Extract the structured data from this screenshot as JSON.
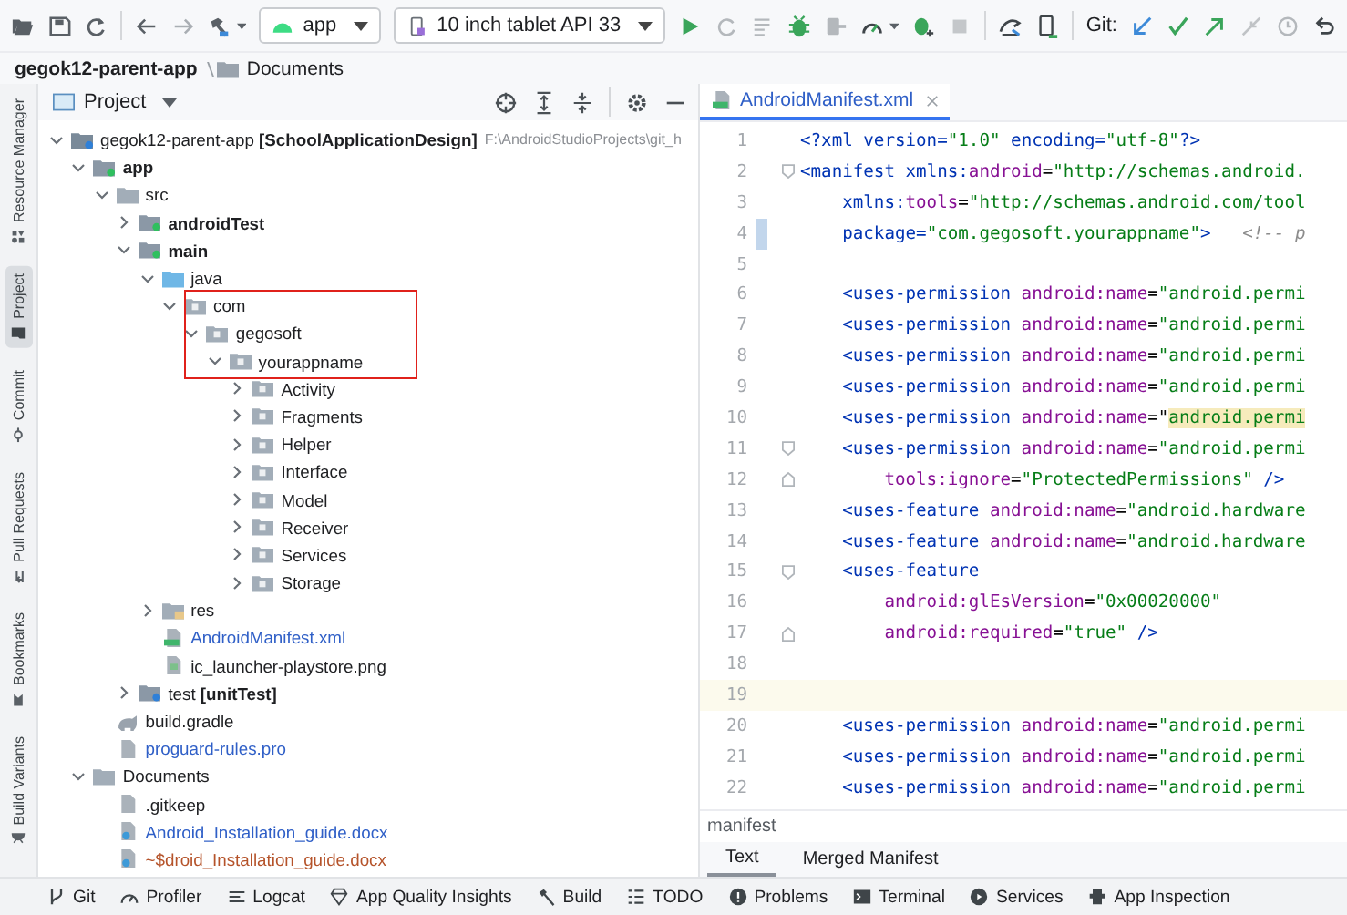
{
  "toolbar": {
    "run_config": "app",
    "device": "10 inch tablet API 33",
    "git_label": "Git:"
  },
  "breadcrumb": [
    {
      "label": "gegok12-parent-app",
      "kind": "project"
    },
    {
      "label": "Documents",
      "kind": "folder"
    }
  ],
  "side_tabs": [
    {
      "label": "Resource Manager",
      "kind": "resources",
      "selected": false
    },
    {
      "label": "Project",
      "kind": "project",
      "selected": true
    },
    {
      "label": "Commit",
      "kind": "commit",
      "selected": false
    },
    {
      "label": "Pull Requests",
      "kind": "pulls",
      "selected": false
    },
    {
      "label": "Bookmarks",
      "kind": "bookmarks",
      "selected": false
    },
    {
      "label": "Build Variants",
      "kind": "variants",
      "selected": false
    }
  ],
  "project_panel": {
    "title": "Project",
    "annotation": {
      "kind": "rectangle"
    },
    "tree": [
      {
        "label": "gegok12-parent-app **[SchoolApplicationDesign]**",
        "path": "F:\\AndroidStudioProjects\\git_h",
        "kind": "project",
        "expanded": true,
        "children": [
          {
            "label": "app",
            "kind": "module",
            "expanded": true,
            "children": [
              {
                "label": "src",
                "kind": "folder",
                "expanded": true,
                "children": [
                  {
                    "label": "androidTest",
                    "kind": "source",
                    "expanded": false
                  },
                  {
                    "label": "main",
                    "kind": "source",
                    "expanded": true,
                    "children": [
                      {
                        "label": "java",
                        "kind": "java",
                        "expanded": true,
                        "children": [
                          {
                            "label": "com",
                            "kind": "package",
                            "expanded": true,
                            "boxed": true,
                            "children": [
                              {
                                "label": "gegosoft",
                                "kind": "package",
                                "expanded": true,
                                "boxed": true,
                                "children": [
                                  {
                                    "label": "yourappname",
                                    "kind": "package",
                                    "expanded": true,
                                    "boxed": true,
                                    "children": [
                                      {
                                        "label": "Activity",
                                        "kind": "package",
                                        "expanded": false
                                      },
                                      {
                                        "label": "Fragments",
                                        "kind": "package",
                                        "expanded": false
                                      },
                                      {
                                        "label": "Helper",
                                        "kind": "package",
                                        "expanded": false
                                      },
                                      {
                                        "label": "Interface",
                                        "kind": "package",
                                        "expanded": false
                                      },
                                      {
                                        "label": "Model",
                                        "kind": "package",
                                        "expanded": false
                                      },
                                      {
                                        "label": "Receiver",
                                        "kind": "package",
                                        "expanded": false
                                      },
                                      {
                                        "label": "Services",
                                        "kind": "package",
                                        "expanded": false
                                      },
                                      {
                                        "label": "Storage",
                                        "kind": "package",
                                        "expanded": false
                                      }
                                    ]
                                  }
                                ]
                              }
                            ]
                          }
                        ]
                      },
                      {
                        "label": "res",
                        "kind": "res",
                        "expanded": false
                      },
                      {
                        "label": "AndroidManifest.xml",
                        "kind": "manifest",
                        "color": "#2f5fc7"
                      },
                      {
                        "label": "ic_launcher-playstore.png",
                        "kind": "image"
                      }
                    ]
                  },
                  {
                    "label": "test **[unitTest]**",
                    "kind": "test",
                    "expanded": false
                  }
                ]
              },
              {
                "label": "build.gradle",
                "kind": "gradle"
              },
              {
                "label": "proguard-rules.pro",
                "kind": "file",
                "color": "#2f5fc7"
              }
            ]
          },
          {
            "label": "Documents",
            "kind": "folder",
            "expanded": true,
            "children": [
              {
                "label": ".gitkeep",
                "kind": "file"
              },
              {
                "label": "Android_Installation_guide.docx",
                "kind": "doc",
                "color": "#2f5fc7"
              },
              {
                "label": "~$droid_Installation_guide.docx",
                "kind": "doc",
                "color": "#b5532a"
              }
            ]
          }
        ]
      }
    ]
  },
  "editor": {
    "tabs": [
      {
        "label": "AndroidManifest.xml",
        "kind": "manifest",
        "selected": true
      }
    ],
    "lines": [
      {
        "number": "1",
        "kind": "flush",
        "current": false,
        "modified": false,
        "fold_start": false,
        "fold_end": false,
        "tokens": [
          {
            "kind": "tag",
            "text": "<?xml version="
          },
          {
            "kind": "value",
            "text": "\"1.0\""
          },
          {
            "kind": "tag",
            "text": " encoding="
          },
          {
            "kind": "value",
            "text": "\"utf-8\""
          },
          {
            "kind": "tag",
            "text": "?>"
          }
        ]
      },
      {
        "number": "2",
        "kind": "flush",
        "current": false,
        "modified": false,
        "fold_start": true,
        "fold_end": false,
        "tokens": [
          {
            "kind": "tag",
            "text": "<manifest "
          },
          {
            "kind": "tag",
            "text": "xmlns:"
          },
          {
            "kind": "name",
            "text": "android"
          },
          {
            "kind": "plain",
            "text": "="
          },
          {
            "kind": "value",
            "text": "\"http://schemas.android."
          }
        ]
      },
      {
        "number": "3",
        "kind": "indented",
        "current": false,
        "modified": false,
        "fold_start": false,
        "fold_end": false,
        "tokens": [
          {
            "kind": "tag",
            "text": "xmlns:"
          },
          {
            "kind": "name",
            "text": "tools"
          },
          {
            "kind": "plain",
            "text": "="
          },
          {
            "kind": "value",
            "text": "\"http://schemas.android.com/tool"
          }
        ]
      },
      {
        "number": "4",
        "kind": "indented",
        "current": false,
        "modified": true,
        "fold_start": false,
        "fold_end": false,
        "tokens": [
          {
            "kind": "tag",
            "text": "package="
          },
          {
            "kind": "value",
            "text": "\"com.gegosoft.yourappname\""
          },
          {
            "kind": "tag",
            "text": ">   "
          },
          {
            "kind": "comment",
            "text": "<!-- p"
          }
        ]
      },
      {
        "number": "5",
        "current": false,
        "modified": false,
        "fold_start": false,
        "fold_end": false
      },
      {
        "number": "6",
        "kind": "indented",
        "current": false,
        "modified": false,
        "fold_start": false,
        "fold_end": false,
        "tokens": [
          {
            "kind": "tag",
            "text": "<uses-permission "
          },
          {
            "kind": "name",
            "text": "android:name"
          },
          {
            "kind": "plain",
            "text": "="
          },
          {
            "kind": "value",
            "text": "\"android.permi"
          }
        ]
      },
      {
        "number": "7",
        "kind": "indented",
        "current": false,
        "modified": false,
        "fold_start": false,
        "fold_end": false,
        "tokens": [
          {
            "kind": "tag",
            "text": "<uses-permission "
          },
          {
            "kind": "name",
            "text": "android:name"
          },
          {
            "kind": "plain",
            "text": "="
          },
          {
            "kind": "value",
            "text": "\"android.permi"
          }
        ]
      },
      {
        "number": "8",
        "kind": "indented",
        "current": false,
        "modified": false,
        "fold_start": false,
        "fold_end": false,
        "tokens": [
          {
            "kind": "tag",
            "text": "<uses-permission "
          },
          {
            "kind": "name",
            "text": "android:name"
          },
          {
            "kind": "plain",
            "text": "="
          },
          {
            "kind": "value",
            "text": "\"android.permi"
          }
        ]
      },
      {
        "number": "9",
        "kind": "indented",
        "current": false,
        "modified": false,
        "fold_start": false,
        "fold_end": false,
        "tokens": [
          {
            "kind": "tag",
            "text": "<uses-permission "
          },
          {
            "kind": "name",
            "text": "android:name"
          },
          {
            "kind": "plain",
            "text": "="
          },
          {
            "kind": "value",
            "text": "\"android.permi"
          }
        ]
      },
      {
        "number": "10",
        "kind": "indented",
        "current": false,
        "modified": false,
        "fold_start": false,
        "fold_end": false,
        "tokens": [
          {
            "kind": "tag",
            "text": "<uses-permission "
          },
          {
            "kind": "name",
            "text": "android:name"
          },
          {
            "kind": "plain",
            "text": "=\""
          },
          {
            "kind": "match",
            "text": "android.permi"
          }
        ]
      },
      {
        "number": "11",
        "kind": "indented",
        "current": false,
        "modified": false,
        "fold_start": true,
        "fold_end": false,
        "tokens": [
          {
            "kind": "tag",
            "text": "<uses-permission "
          },
          {
            "kind": "name",
            "text": "android:name"
          },
          {
            "kind": "plain",
            "text": "="
          },
          {
            "kind": "value",
            "text": "\"android.permi"
          }
        ]
      },
      {
        "number": "12",
        "kind": "double-indented",
        "current": false,
        "modified": false,
        "fold_start": false,
        "fold_end": true,
        "tokens": [
          {
            "kind": "name",
            "text": "tools:ignore"
          },
          {
            "kind": "plain",
            "text": "="
          },
          {
            "kind": "value",
            "text": "\"ProtectedPermissions\""
          },
          {
            "kind": "tag",
            "text": " />"
          }
        ]
      },
      {
        "number": "13",
        "kind": "indented",
        "current": false,
        "modified": false,
        "fold_start": false,
        "fold_end": false,
        "tokens": [
          {
            "kind": "tag",
            "text": "<uses-feature "
          },
          {
            "kind": "name",
            "text": "android:name"
          },
          {
            "kind": "plain",
            "text": "="
          },
          {
            "kind": "value",
            "text": "\"android.hardware"
          }
        ]
      },
      {
        "number": "14",
        "kind": "indented",
        "current": false,
        "modified": false,
        "fold_start": false,
        "fold_end": false,
        "tokens": [
          {
            "kind": "tag",
            "text": "<uses-feature "
          },
          {
            "kind": "name",
            "text": "android:name"
          },
          {
            "kind": "plain",
            "text": "="
          },
          {
            "kind": "value",
            "text": "\"android.hardware"
          }
        ]
      },
      {
        "number": "15",
        "kind": "indented",
        "current": false,
        "modified": false,
        "fold_start": true,
        "fold_end": false,
        "tokens": [
          {
            "kind": "tag",
            "text": "<uses-feature"
          }
        ]
      },
      {
        "number": "16",
        "kind": "double-indented",
        "current": false,
        "modified": false,
        "fold_start": false,
        "fold_end": false,
        "tokens": [
          {
            "kind": "name",
            "text": "android:glEsVersion"
          },
          {
            "kind": "plain",
            "text": "="
          },
          {
            "kind": "value",
            "text": "\"0x00020000\""
          }
        ]
      },
      {
        "number": "17",
        "kind": "double-indented",
        "current": false,
        "modified": false,
        "fold_start": false,
        "fold_end": true,
        "tokens": [
          {
            "kind": "name",
            "text": "android:required"
          },
          {
            "kind": "plain",
            "text": "="
          },
          {
            "kind": "value",
            "text": "\"true\""
          },
          {
            "kind": "tag",
            "text": " />"
          }
        ]
      },
      {
        "number": "18",
        "current": false,
        "modified": false,
        "fold_start": false,
        "fold_end": false
      },
      {
        "number": "19",
        "current": true,
        "modified": false,
        "fold_start": false,
        "fold_end": false
      },
      {
        "number": "20",
        "kind": "indented",
        "current": false,
        "modified": false,
        "fold_start": false,
        "fold_end": false,
        "tokens": [
          {
            "kind": "tag",
            "text": "<uses-permission "
          },
          {
            "kind": "name",
            "text": "android:name"
          },
          {
            "kind": "plain",
            "text": "="
          },
          {
            "kind": "value",
            "text": "\"android.permi"
          }
        ]
      },
      {
        "number": "21",
        "kind": "indented",
        "current": false,
        "modified": false,
        "fold_start": false,
        "fold_end": false,
        "tokens": [
          {
            "kind": "tag",
            "text": "<uses-permission "
          },
          {
            "kind": "name",
            "text": "android:name"
          },
          {
            "kind": "plain",
            "text": "="
          },
          {
            "kind": "value",
            "text": "\"android.permi"
          }
        ]
      },
      {
        "number": "22",
        "kind": "indented",
        "current": false,
        "modified": false,
        "fold_start": false,
        "fold_end": false,
        "tokens": [
          {
            "kind": "tag",
            "text": "<uses-permission "
          },
          {
            "kind": "name",
            "text": "android:name"
          },
          {
            "kind": "plain",
            "text": "="
          },
          {
            "kind": "value",
            "text": "\"android.permi"
          }
        ]
      }
    ],
    "breadcrumb": "manifest",
    "bottom_tabs": [
      {
        "label": "Text",
        "selected": true
      },
      {
        "label": "Merged Manifest",
        "selected": false
      }
    ]
  },
  "tool_windows": [
    {
      "label": "Git",
      "kind": "git"
    },
    {
      "label": "Profiler",
      "kind": "profiler"
    },
    {
      "label": "Logcat",
      "kind": "logcat"
    },
    {
      "label": "App Quality Insights",
      "kind": "insights"
    },
    {
      "label": "Build",
      "kind": "build"
    },
    {
      "label": "TODO",
      "kind": "todo"
    },
    {
      "label": "Problems",
      "kind": "problems"
    },
    {
      "label": "Terminal",
      "kind": "terminal"
    },
    {
      "label": "Services",
      "kind": "services"
    },
    {
      "label": "App Inspection",
      "kind": "inspection"
    }
  ]
}
